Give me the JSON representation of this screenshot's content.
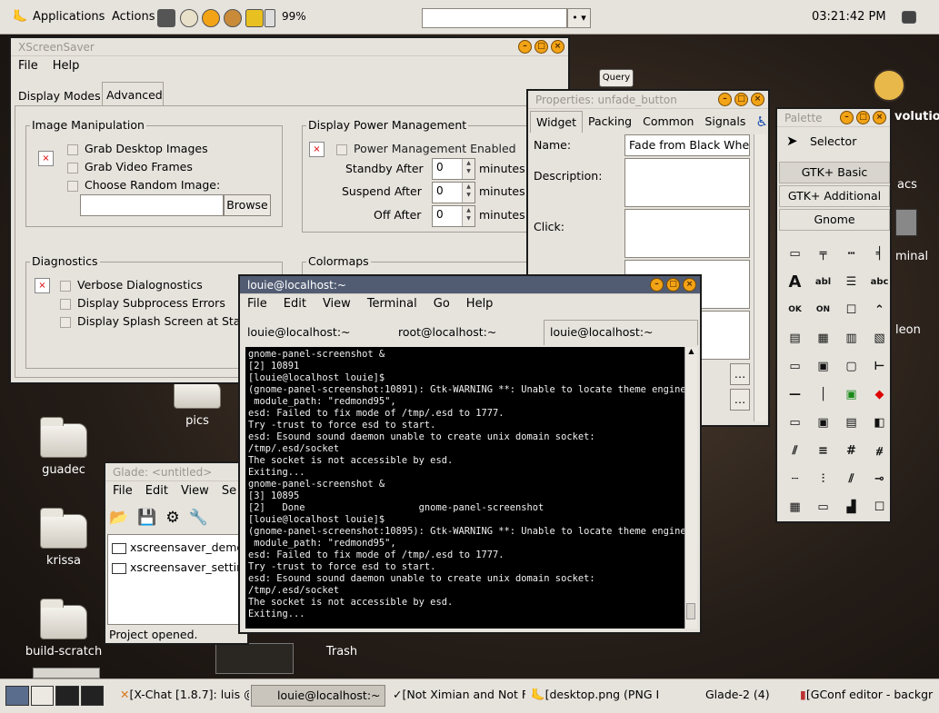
{
  "top_panel": {
    "applications": "Applications",
    "actions": "Actions",
    "battery": "99%",
    "clock": "03:21:42 PM"
  },
  "desktop_icons": [
    {
      "label": "guadec"
    },
    {
      "label": "krissa"
    },
    {
      "label": "build-scratch"
    },
    {
      "label": "pics"
    },
    {
      "label": "Trash"
    }
  ],
  "desktop_right_labels": {
    "evolution": "volutio",
    "emacs": "acs",
    "terminal": "minal",
    "chameleon": "leon"
  },
  "query_label": "Query",
  "xscreensaver": {
    "title": "XScreenSaver",
    "menu": [
      "File",
      "Help"
    ],
    "tabs": [
      "Display Modes",
      "Advanced"
    ],
    "image_manip": {
      "label": "Image Manipulation",
      "grab_desktop": "Grab Desktop Images",
      "grab_video": "Grab Video Frames",
      "choose_random": "Choose Random Image:",
      "browse": "Browse"
    },
    "dpm": {
      "label": "Display Power Management",
      "enabled": "Power Management Enabled",
      "standby": "Standby After",
      "suspend": "Suspend After",
      "off": "Off After",
      "value": "0",
      "unit": "minutes"
    },
    "diagnostics": {
      "label": "Diagnostics",
      "verbose": "Verbose Dialognostics",
      "subprocess": "Display Subprocess Errors",
      "splash": "Display Splash Screen at Start"
    },
    "colormaps": "Colormaps"
  },
  "properties": {
    "title": "Properties: unfade_button",
    "tabs": [
      "Widget",
      "Packing",
      "Common",
      "Signals"
    ],
    "name_label": "Name:",
    "name_value": "Fade from Black Wher",
    "description_label": "Description:",
    "click_label": "Click:"
  },
  "palette": {
    "title": "Palette",
    "selector": "Selector",
    "groups": [
      "GTK+ Basic",
      "GTK+ Additional",
      "Gnome"
    ]
  },
  "glade": {
    "title": "Glade: <untitled>",
    "menu": [
      "File",
      "Edit",
      "View",
      "Se"
    ],
    "items": [
      "xscreensaver_demo",
      "xscreensaver_settin"
    ],
    "status": "Project opened."
  },
  "terminal": {
    "title": "louie@localhost:~",
    "menu": [
      "File",
      "Edit",
      "View",
      "Terminal",
      "Go",
      "Help"
    ],
    "tabs": [
      "louie@localhost:~",
      "root@localhost:~",
      "louie@localhost:~"
    ],
    "output": "gnome-panel-screenshot &\n[2] 10891\n[louie@localhost louie]$\n(gnome-panel-screenshot:10891): Gtk-WARNING **: Unable to locate theme engine in\n module_path: \"redmond95\",\nesd: Failed to fix mode of /tmp/.esd to 1777.\nTry -trust to force esd to start.\nesd: Esound sound daemon unable to create unix domain socket:\n/tmp/.esd/socket\nThe socket is not accessible by esd.\nExiting...\ngnome-panel-screenshot &\n[3] 10895\n[2]   Done                    gnome-panel-screenshot\n[louie@localhost louie]$\n(gnome-panel-screenshot:10895): Gtk-WARNING **: Unable to locate theme engine in\n module_path: \"redmond95\",\nesd: Failed to fix mode of /tmp/.esd to 1777.\nTry -trust to force esd to start.\nesd: Esound sound daemon unable to create unix domain socket:\n/tmp/.esd/socket\nThe socket is not accessible by esd.\nExiting..."
  },
  "taskbar": [
    {
      "label": "[X-Chat [1.8.7]: luis @",
      "selected": false
    },
    {
      "label": "louie@localhost:~",
      "selected": true
    },
    {
      "label": "[Not Ximian and Not F",
      "selected": false
    },
    {
      "label": "[desktop.png (PNG Im",
      "selected": false
    },
    {
      "label": "Glade-2 (4)",
      "selected": false
    },
    {
      "label": "[GConf editor - backgr",
      "selected": false
    }
  ]
}
